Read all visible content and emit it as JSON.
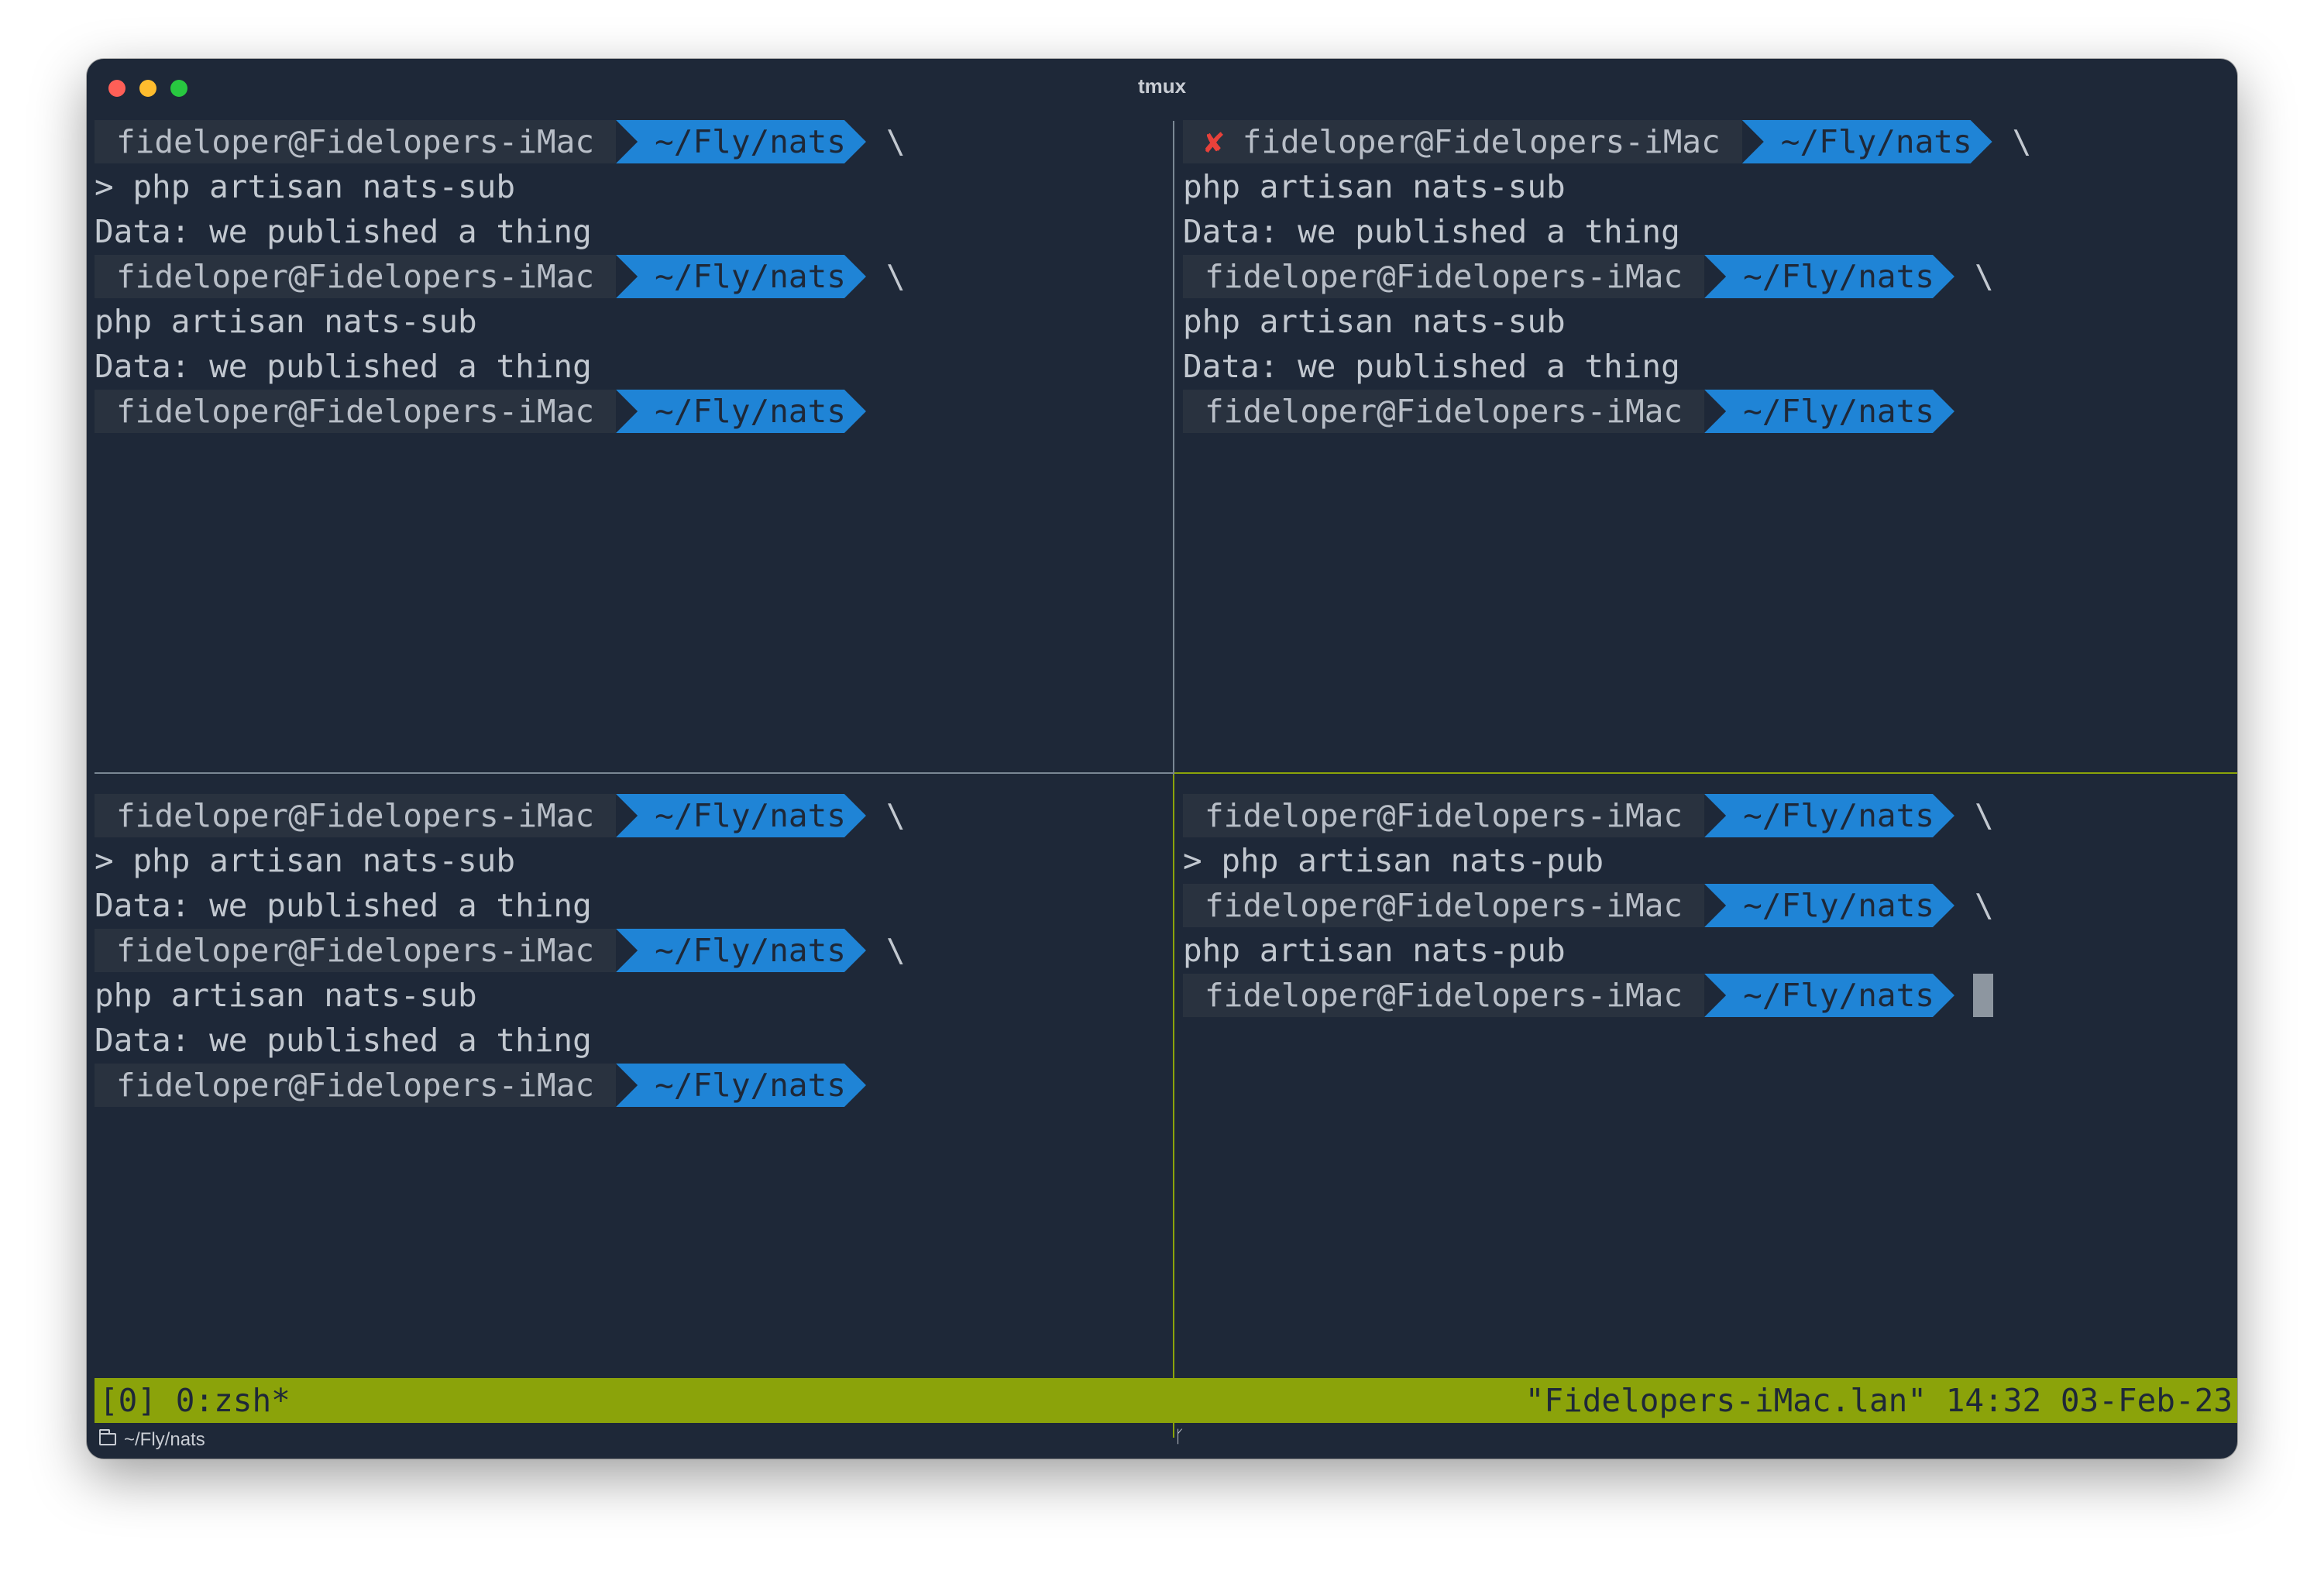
{
  "window": {
    "title": "tmux"
  },
  "prompt": {
    "user": "fideloper@Fidelopers-iMac",
    "path": "~/Fly/nats",
    "continuation": "\\",
    "error_mark": "✘"
  },
  "panes": {
    "top_left": {
      "lines": [
        {
          "kind": "prompt",
          "cont": true,
          "err": false
        },
        {
          "kind": "text",
          "text": "> php artisan nats-sub"
        },
        {
          "kind": "text",
          "text": "Data: we published a thing"
        },
        {
          "kind": "prompt",
          "cont": true,
          "err": false
        },
        {
          "kind": "text",
          "text": "php artisan nats-sub"
        },
        {
          "kind": "text",
          "text": "Data: we published a thing"
        },
        {
          "kind": "prompt",
          "cont": false,
          "err": false
        }
      ]
    },
    "top_right": {
      "lines": [
        {
          "kind": "prompt",
          "cont": true,
          "err": true
        },
        {
          "kind": "text",
          "text": "php artisan nats-sub"
        },
        {
          "kind": "text",
          "text": "Data: we published a thing"
        },
        {
          "kind": "prompt",
          "cont": true,
          "err": false
        },
        {
          "kind": "text",
          "text": "php artisan nats-sub"
        },
        {
          "kind": "text",
          "text": "Data: we published a thing"
        },
        {
          "kind": "prompt",
          "cont": false,
          "err": false
        }
      ]
    },
    "bottom_left": {
      "lines": [
        {
          "kind": "prompt",
          "cont": true,
          "err": false
        },
        {
          "kind": "text",
          "text": "> php artisan nats-sub"
        },
        {
          "kind": "text",
          "text": "Data: we published a thing"
        },
        {
          "kind": "prompt",
          "cont": true,
          "err": false
        },
        {
          "kind": "text",
          "text": "php artisan nats-sub"
        },
        {
          "kind": "text",
          "text": "Data: we published a thing"
        },
        {
          "kind": "prompt",
          "cont": false,
          "err": false
        }
      ]
    },
    "bottom_right": {
      "lines": [
        {
          "kind": "prompt",
          "cont": true,
          "err": false
        },
        {
          "kind": "text",
          "text": "> php artisan nats-pub"
        },
        {
          "kind": "prompt",
          "cont": true,
          "err": false
        },
        {
          "kind": "text",
          "text": "php artisan nats-pub"
        },
        {
          "kind": "prompt",
          "cont": false,
          "err": false,
          "cursor": true
        }
      ]
    }
  },
  "statusbar": {
    "left": "[0] 0:zsh*",
    "right": "\"Fidelopers-iMac.lan\" 14:32 03-Feb-23"
  },
  "footer": {
    "path": "~/Fly/nats",
    "branch_icon": "git-branch-icon"
  },
  "colors": {
    "background": "#1e2838",
    "user_segment": "#29323f",
    "path_segment": "#1f84d6",
    "status_bar": "#8ba30a",
    "error": "#e8413a"
  }
}
